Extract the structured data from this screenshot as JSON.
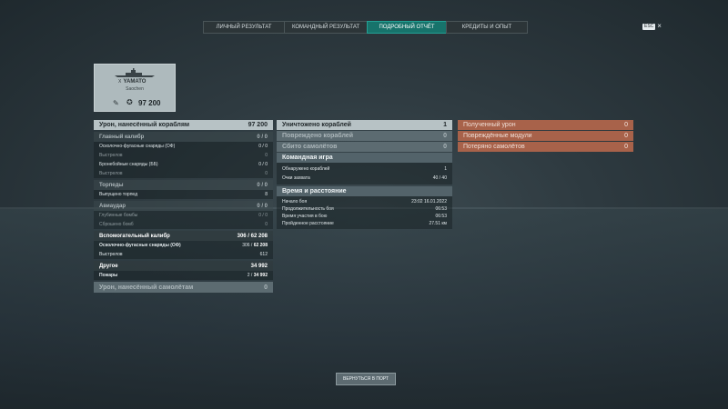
{
  "tabs": [
    {
      "label": "ЛИЧНЫЙ РЕЗУЛЬТАТ"
    },
    {
      "label": "КОМАНДНЫЙ РЕЗУЛЬТАТ"
    },
    {
      "label": "ПОДРОБНЫЙ ОТЧЁТ"
    },
    {
      "label": "КРЕДИТЫ И ОПЫТ"
    }
  ],
  "active_tab": "ПОДРОБНЫЙ ОТЧЁТ",
  "esc": {
    "key": "ESC",
    "close": "×"
  },
  "ship": {
    "tier": "X",
    "name": "YAMATO",
    "player": "Saochen",
    "damage": "97 200"
  },
  "left": {
    "main": {
      "label": "Урон, нанесённый кораблям",
      "value": "97 200"
    },
    "main_caliber": {
      "label": "Главный калибр",
      "value": "0 / 0",
      "rows": [
        {
          "label": "Осколочно-фугасные снаряды (ОФ)",
          "value": "0 / 0"
        },
        {
          "label": "Выстрелов",
          "value": "0"
        },
        {
          "label": "Бронебойные снаряды (ББ)",
          "value": "0 / 0"
        },
        {
          "label": "Выстрелов",
          "value": "0"
        }
      ]
    },
    "torpedoes": {
      "label": "Торпеды",
      "value": "0 / 0",
      "rows": [
        {
          "label": "Выпущено торпед",
          "value": "8"
        }
      ]
    },
    "airstrike": {
      "label": "Авиаудар",
      "value": "0 / 0",
      "rows": [
        {
          "label": "Глубинные бомбы",
          "value": "0 / 0"
        },
        {
          "label": "Сброшено бомб",
          "value": "0"
        }
      ]
    },
    "secondary": {
      "label": "Вспомогательный калибр",
      "value_a": "306",
      "value_b": "62 208",
      "rows": [
        {
          "label": "Осколочно-фугасные снаряды (ОФ)",
          "value_a": "306",
          "value_b": "62 208"
        },
        {
          "label": "Выстрелов",
          "value": "612"
        }
      ]
    },
    "other": {
      "label": "Другое",
      "value": "34 992",
      "rows": [
        {
          "label": "Пожары",
          "value_a": "2",
          "value_b": "34 992"
        }
      ]
    },
    "aircraft": {
      "label": "Урон, нанесённый самолётам",
      "value": "0"
    }
  },
  "middle": {
    "destroyed": {
      "label": "Уничтожено кораблей",
      "value": "1"
    },
    "damaged": {
      "label": "Повреждено кораблей",
      "value": "0"
    },
    "planes": {
      "label": "Сбито самолётов",
      "value": "0"
    },
    "team": {
      "label": "Командная игра",
      "rows": [
        {
          "label": "Обнаружено кораблей",
          "value": "1"
        },
        {
          "label": "Очки захвата",
          "value": "40 / 40"
        }
      ]
    },
    "time": {
      "label": "Время и расстояние",
      "rows": [
        {
          "label": "Начало боя",
          "value": "23:02  16.01.2022"
        },
        {
          "label": "Продолжительность боя",
          "value": "06:53"
        },
        {
          "label": "Время участия в бою",
          "value": "06:53"
        },
        {
          "label": "Пройденное расстояние",
          "value": "27.51 км"
        }
      ]
    }
  },
  "right": {
    "received": {
      "label": "Полученный урон",
      "value": "0"
    },
    "modules": {
      "label": "Повреждённые модули",
      "value": "0"
    },
    "planes_lost": {
      "label": "Потеряно самолётов",
      "value": "0"
    }
  },
  "footer": {
    "button": "ВЕРНУТЬСЯ В ПОРТ"
  },
  "colors": {
    "accent_tab": "#17736b",
    "loss_row": "#a8624a",
    "header_light": "#b7c2c5"
  }
}
